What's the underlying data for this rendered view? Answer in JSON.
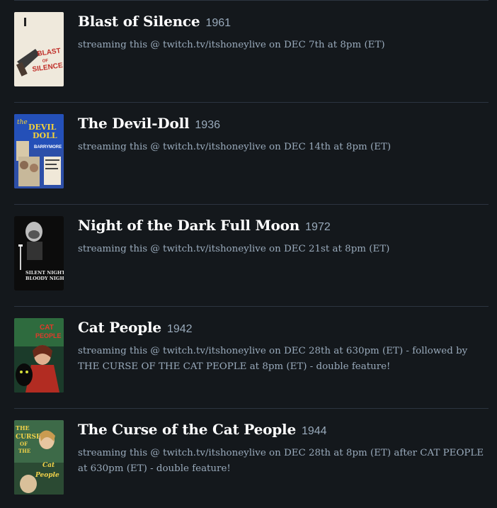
{
  "entries": [
    {
      "title": "Blast of Silence",
      "year": "1961",
      "note": "streaming this @ twitch.tv/itshoneylive on DEC 7th at 8pm (ET)",
      "poster_text": [
        "BLAST",
        "OF",
        "SILENCE"
      ]
    },
    {
      "title": "The Devil-Doll",
      "year": "1936",
      "note": "streaming this @ twitch.tv/itshoneylive on DEC 14th at 8pm (ET)",
      "poster_text": [
        "the",
        "DEVIL",
        "DOLL",
        "BARRYMORE"
      ]
    },
    {
      "title": "Night of the Dark Full Moon",
      "year": "1972",
      "note": "streaming this @ twitch.tv/itshoneylive on DEC 21st at 8pm (ET)",
      "poster_text": [
        "SILENT NIGHT",
        "BLOODY NIGHT"
      ]
    },
    {
      "title": "Cat People",
      "year": "1942",
      "note": "streaming this @ twitch.tv/itshoneylive on DEC 28th at 630pm (ET) - followed by THE CURSE OF THE CAT PEOPLE at 8pm (ET) - double feature!",
      "poster_text": [
        "CAT",
        "PEOPLE"
      ]
    },
    {
      "title": "The Curse of the Cat People",
      "year": "1944",
      "note": "streaming this @ twitch.tv/itshoneylive on DEC 28th at 8pm (ET) after CAT PEOPLE at 630pm (ET) - double feature!",
      "poster_text": [
        "THE",
        "CURSE",
        "OF",
        "THE",
        "Cat",
        "People"
      ]
    }
  ]
}
